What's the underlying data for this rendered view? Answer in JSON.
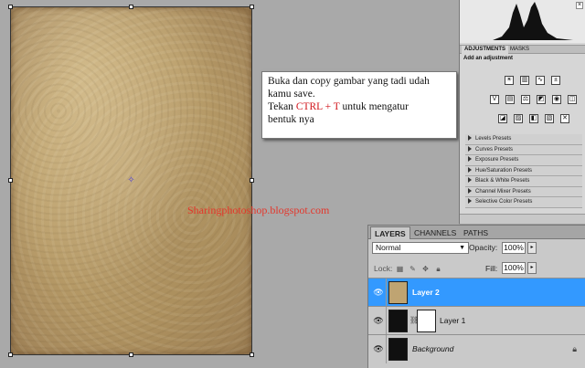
{
  "note": {
    "line1": "Buka dan copy gambar yang tadi udah",
    "line2": "kamu save.",
    "line3_prefix": "Tekan ",
    "line3_highlight": "CTRL + T",
    "line3_suffix": " untuk mengatur",
    "line4": "bentuk nya"
  },
  "watermark": "Sharingphotoshop.blogspot.com",
  "adjustments": {
    "tabs": [
      "ADJUSTMENTS",
      "MASKS"
    ],
    "title": "Add an adjustment",
    "presets": [
      "Levels Presets",
      "Curves Presets",
      "Exposure Presets",
      "Hue/Saturation Presets",
      "Black & White Presets",
      "Channel Mixer Presets",
      "Selective Color Presets"
    ]
  },
  "layers_panel": {
    "tabs": [
      "LAYERS",
      "CHANNELS",
      "PATHS"
    ],
    "blend_mode": "Normal",
    "opacity_label": "Opacity:",
    "opacity_value": "100%",
    "lock_label": "Lock:",
    "fill_label": "Fill:",
    "fill_value": "100%",
    "layers": [
      {
        "name": "Layer 2",
        "selected": true
      },
      {
        "name": "Layer 1",
        "selected": false
      },
      {
        "name": "Background",
        "selected": false
      }
    ]
  },
  "colors": {
    "selection_blue": "#3399ff",
    "highlight_red": "#d1141b",
    "watermark_red": "#e4362b"
  }
}
